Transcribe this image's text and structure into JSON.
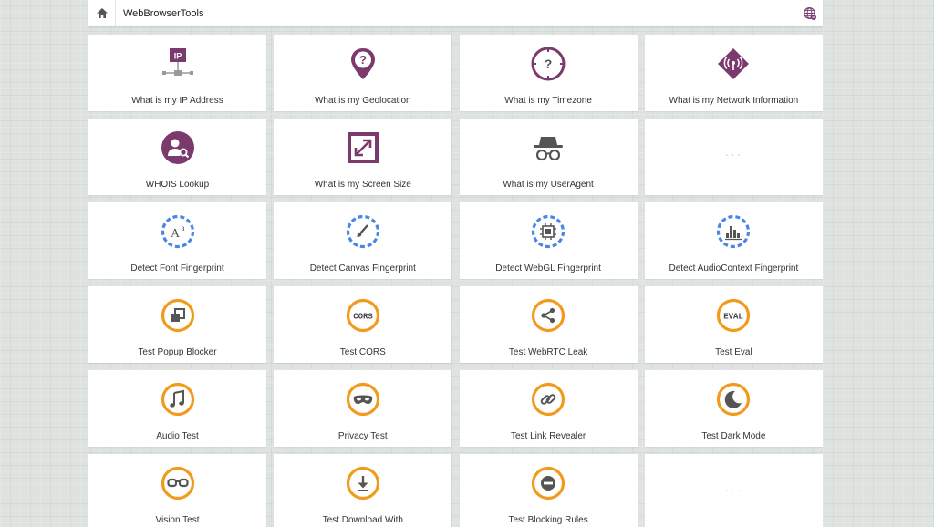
{
  "header": {
    "title": "WebBrowserTools",
    "home_icon": "home-icon",
    "language_icon": "globe-icon"
  },
  "colors": {
    "purple": "#7b3a6c",
    "blue_dash": "#4a86e8",
    "orange": "#f29a1c",
    "dark_icon": "#555555"
  },
  "tiles": [
    {
      "label": "What is my IP Address",
      "icon": "ip-network-icon"
    },
    {
      "label": "What is my Geolocation",
      "icon": "location-pin-question-icon"
    },
    {
      "label": "What is my Timezone",
      "icon": "clock-question-icon"
    },
    {
      "label": "What is my Network Information",
      "icon": "network-signal-icon"
    },
    {
      "label": "WHOIS Lookup",
      "icon": "user-search-icon"
    },
    {
      "label": "What is my Screen Size",
      "icon": "screen-resize-icon"
    },
    {
      "label": "What is my UserAgent",
      "icon": "incognito-icon"
    },
    {
      "label": "···",
      "icon": "more-icon"
    },
    {
      "label": "Detect Font Fingerprint",
      "icon": "font-fingerprint-icon"
    },
    {
      "label": "Detect Canvas Fingerprint",
      "icon": "canvas-fingerprint-icon"
    },
    {
      "label": "Detect WebGL Fingerprint",
      "icon": "webgl-fingerprint-icon"
    },
    {
      "label": "Detect AudioContext Fingerprint",
      "icon": "audio-fingerprint-icon"
    },
    {
      "label": "Test Popup Blocker",
      "icon": "popup-icon"
    },
    {
      "label": "Test CORS",
      "icon": "cors-icon",
      "badge": "CORS"
    },
    {
      "label": "Test WebRTC Leak",
      "icon": "share-icon"
    },
    {
      "label": "Test Eval",
      "icon": "eval-icon",
      "badge": "EVAL"
    },
    {
      "label": "Audio Test",
      "icon": "music-note-icon"
    },
    {
      "label": "Privacy Test",
      "icon": "mask-icon"
    },
    {
      "label": "Test Link Revealer",
      "icon": "link-icon"
    },
    {
      "label": "Test Dark Mode",
      "icon": "moon-icon"
    },
    {
      "label": "Vision Test",
      "icon": "glasses-icon"
    },
    {
      "label": "Test Download With",
      "icon": "download-icon"
    },
    {
      "label": "Test Blocking Rules",
      "icon": "block-icon"
    },
    {
      "label": "···",
      "icon": "more-icon"
    }
  ]
}
